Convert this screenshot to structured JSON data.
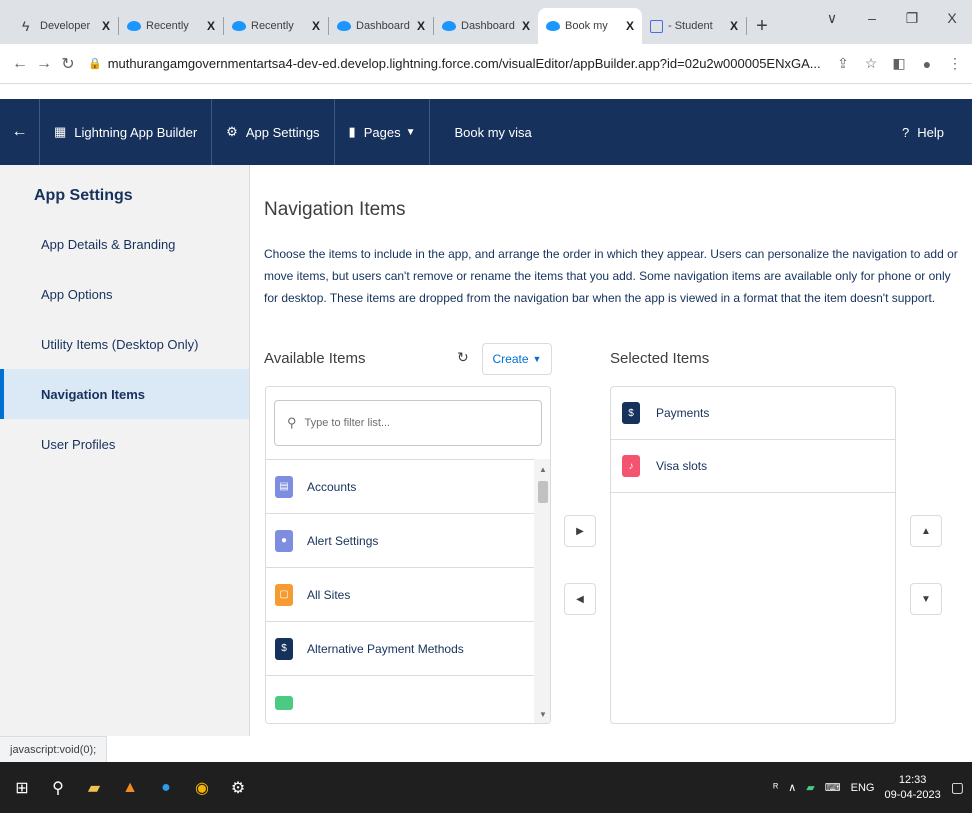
{
  "browser": {
    "tabs": [
      {
        "title": "Developer",
        "favicon": "bolt-icon",
        "active": false
      },
      {
        "title": "Recently",
        "favicon": "salesforce-cloud-icon",
        "active": false
      },
      {
        "title": "Recently",
        "favicon": "salesforce-cloud-icon",
        "active": false
      },
      {
        "title": "Dashboard",
        "favicon": "salesforce-cloud-icon",
        "active": false
      },
      {
        "title": "Dashboard",
        "favicon": "salesforce-cloud-icon",
        "active": false
      },
      {
        "title": "Book my",
        "favicon": "salesforce-cloud-icon",
        "active": true
      },
      {
        "title": "- Student",
        "favicon": "document-icon",
        "active": false
      }
    ],
    "close_glyph": "X",
    "new_tab_glyph": "+",
    "window_controls": [
      "∨",
      "–",
      "❐",
      "X"
    ],
    "url": "muthurangamgovernmentartsa4-dev-ed.develop.lightning.force.com/visualEditor/appBuilder.app?id=02u2w000005ENxGA..."
  },
  "builder": {
    "app_builder_label": "Lightning App Builder",
    "app_settings_label": "App Settings",
    "pages_label": "Pages",
    "app_name": "Book my visa",
    "help_label": "Help"
  },
  "sidebar": {
    "heading": "App Settings",
    "items": [
      {
        "label": "App Details & Branding",
        "active": false
      },
      {
        "label": "App Options",
        "active": false
      },
      {
        "label": "Utility Items (Desktop Only)",
        "active": false
      },
      {
        "label": "Navigation Items",
        "active": true
      },
      {
        "label": "User Profiles",
        "active": false
      }
    ]
  },
  "main": {
    "title": "Navigation Items",
    "description": "Choose the items to include in the app, and arrange the order in which they appear. Users can personalize the navigation to add or move items, but users can't remove or rename the items that you add. Some navigation items are available only for phone or only for desktop. These items are dropped from the navigation bar when the app is viewed in a format that the item doesn't support.",
    "available_label": "Available Items",
    "create_label": "Create",
    "filter_placeholder": "Type to filter list...",
    "selected_label": "Selected Items",
    "available_items": [
      {
        "label": "Accounts",
        "color": "#7f8de1"
      },
      {
        "label": "Alert Settings",
        "color": "#7f8de1"
      },
      {
        "label": "All Sites",
        "color": "#f59b32"
      },
      {
        "label": "Alternative Payment Methods",
        "color": "#16325c"
      }
    ],
    "selected_items": [
      {
        "label": "Payments",
        "color": "#16325c"
      },
      {
        "label": "Visa slots",
        "color": "#f4546f"
      }
    ]
  },
  "status_text": "javascript:void(0);",
  "taskbar": {
    "language": "ENG",
    "time": "12:33",
    "date": "09-04-2023"
  }
}
